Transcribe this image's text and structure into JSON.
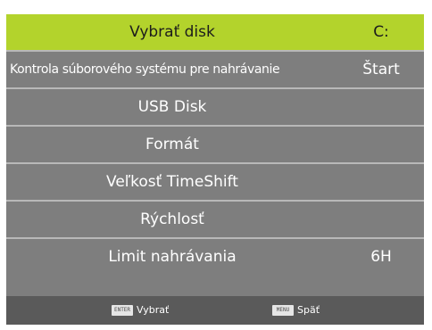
{
  "menu": {
    "items": [
      {
        "label": "Vybrať disk",
        "value": "C:"
      },
      {
        "label": "Kontrola súborového systému pre nahrávanie",
        "value": "Štart"
      },
      {
        "label": "USB Disk",
        "value": ""
      },
      {
        "label": "Formát",
        "value": ""
      },
      {
        "label": "Veľkosť TimeShift",
        "value": ""
      },
      {
        "label": "Rýchlosť",
        "value": ""
      },
      {
        "label": "Limit nahrávania",
        "value": "6H"
      }
    ],
    "colors": {
      "selected": "#b3d32c",
      "row": "#7e7e7e",
      "divider": "#b8b8b8",
      "footer": "#5a5a5a"
    }
  },
  "footer": {
    "enter_key": "ENTER",
    "enter_label": "Vybrať",
    "menu_key": "MENU",
    "menu_label": "Späť"
  }
}
